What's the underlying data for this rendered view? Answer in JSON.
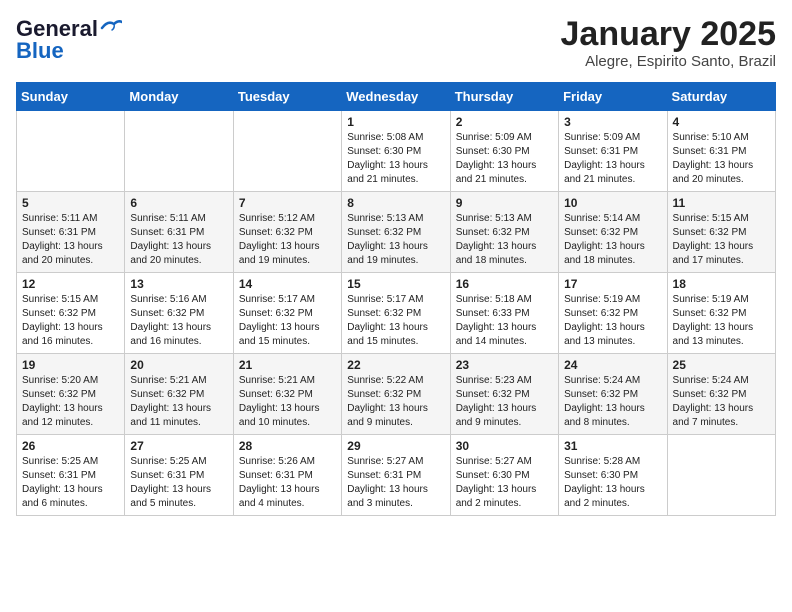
{
  "header": {
    "logo_line1": "General",
    "logo_line2": "Blue",
    "month": "January 2025",
    "location": "Alegre, Espirito Santo, Brazil"
  },
  "weekdays": [
    "Sunday",
    "Monday",
    "Tuesday",
    "Wednesday",
    "Thursday",
    "Friday",
    "Saturday"
  ],
  "rows": [
    [
      {
        "day": "",
        "info": ""
      },
      {
        "day": "",
        "info": ""
      },
      {
        "day": "",
        "info": ""
      },
      {
        "day": "1",
        "info": "Sunrise: 5:08 AM\nSunset: 6:30 PM\nDaylight: 13 hours\nand 21 minutes."
      },
      {
        "day": "2",
        "info": "Sunrise: 5:09 AM\nSunset: 6:30 PM\nDaylight: 13 hours\nand 21 minutes."
      },
      {
        "day": "3",
        "info": "Sunrise: 5:09 AM\nSunset: 6:31 PM\nDaylight: 13 hours\nand 21 minutes."
      },
      {
        "day": "4",
        "info": "Sunrise: 5:10 AM\nSunset: 6:31 PM\nDaylight: 13 hours\nand 20 minutes."
      }
    ],
    [
      {
        "day": "5",
        "info": "Sunrise: 5:11 AM\nSunset: 6:31 PM\nDaylight: 13 hours\nand 20 minutes."
      },
      {
        "day": "6",
        "info": "Sunrise: 5:11 AM\nSunset: 6:31 PM\nDaylight: 13 hours\nand 20 minutes."
      },
      {
        "day": "7",
        "info": "Sunrise: 5:12 AM\nSunset: 6:32 PM\nDaylight: 13 hours\nand 19 minutes."
      },
      {
        "day": "8",
        "info": "Sunrise: 5:13 AM\nSunset: 6:32 PM\nDaylight: 13 hours\nand 19 minutes."
      },
      {
        "day": "9",
        "info": "Sunrise: 5:13 AM\nSunset: 6:32 PM\nDaylight: 13 hours\nand 18 minutes."
      },
      {
        "day": "10",
        "info": "Sunrise: 5:14 AM\nSunset: 6:32 PM\nDaylight: 13 hours\nand 18 minutes."
      },
      {
        "day": "11",
        "info": "Sunrise: 5:15 AM\nSunset: 6:32 PM\nDaylight: 13 hours\nand 17 minutes."
      }
    ],
    [
      {
        "day": "12",
        "info": "Sunrise: 5:15 AM\nSunset: 6:32 PM\nDaylight: 13 hours\nand 16 minutes."
      },
      {
        "day": "13",
        "info": "Sunrise: 5:16 AM\nSunset: 6:32 PM\nDaylight: 13 hours\nand 16 minutes."
      },
      {
        "day": "14",
        "info": "Sunrise: 5:17 AM\nSunset: 6:32 PM\nDaylight: 13 hours\nand 15 minutes."
      },
      {
        "day": "15",
        "info": "Sunrise: 5:17 AM\nSunset: 6:32 PM\nDaylight: 13 hours\nand 15 minutes."
      },
      {
        "day": "16",
        "info": "Sunrise: 5:18 AM\nSunset: 6:33 PM\nDaylight: 13 hours\nand 14 minutes."
      },
      {
        "day": "17",
        "info": "Sunrise: 5:19 AM\nSunset: 6:32 PM\nDaylight: 13 hours\nand 13 minutes."
      },
      {
        "day": "18",
        "info": "Sunrise: 5:19 AM\nSunset: 6:32 PM\nDaylight: 13 hours\nand 13 minutes."
      }
    ],
    [
      {
        "day": "19",
        "info": "Sunrise: 5:20 AM\nSunset: 6:32 PM\nDaylight: 13 hours\nand 12 minutes."
      },
      {
        "day": "20",
        "info": "Sunrise: 5:21 AM\nSunset: 6:32 PM\nDaylight: 13 hours\nand 11 minutes."
      },
      {
        "day": "21",
        "info": "Sunrise: 5:21 AM\nSunset: 6:32 PM\nDaylight: 13 hours\nand 10 minutes."
      },
      {
        "day": "22",
        "info": "Sunrise: 5:22 AM\nSunset: 6:32 PM\nDaylight: 13 hours\nand 9 minutes."
      },
      {
        "day": "23",
        "info": "Sunrise: 5:23 AM\nSunset: 6:32 PM\nDaylight: 13 hours\nand 9 minutes."
      },
      {
        "day": "24",
        "info": "Sunrise: 5:24 AM\nSunset: 6:32 PM\nDaylight: 13 hours\nand 8 minutes."
      },
      {
        "day": "25",
        "info": "Sunrise: 5:24 AM\nSunset: 6:32 PM\nDaylight: 13 hours\nand 7 minutes."
      }
    ],
    [
      {
        "day": "26",
        "info": "Sunrise: 5:25 AM\nSunset: 6:31 PM\nDaylight: 13 hours\nand 6 minutes."
      },
      {
        "day": "27",
        "info": "Sunrise: 5:25 AM\nSunset: 6:31 PM\nDaylight: 13 hours\nand 5 minutes."
      },
      {
        "day": "28",
        "info": "Sunrise: 5:26 AM\nSunset: 6:31 PM\nDaylight: 13 hours\nand 4 minutes."
      },
      {
        "day": "29",
        "info": "Sunrise: 5:27 AM\nSunset: 6:31 PM\nDaylight: 13 hours\nand 3 minutes."
      },
      {
        "day": "30",
        "info": "Sunrise: 5:27 AM\nSunset: 6:30 PM\nDaylight: 13 hours\nand 2 minutes."
      },
      {
        "day": "31",
        "info": "Sunrise: 5:28 AM\nSunset: 6:30 PM\nDaylight: 13 hours\nand 2 minutes."
      },
      {
        "day": "",
        "info": ""
      }
    ]
  ]
}
